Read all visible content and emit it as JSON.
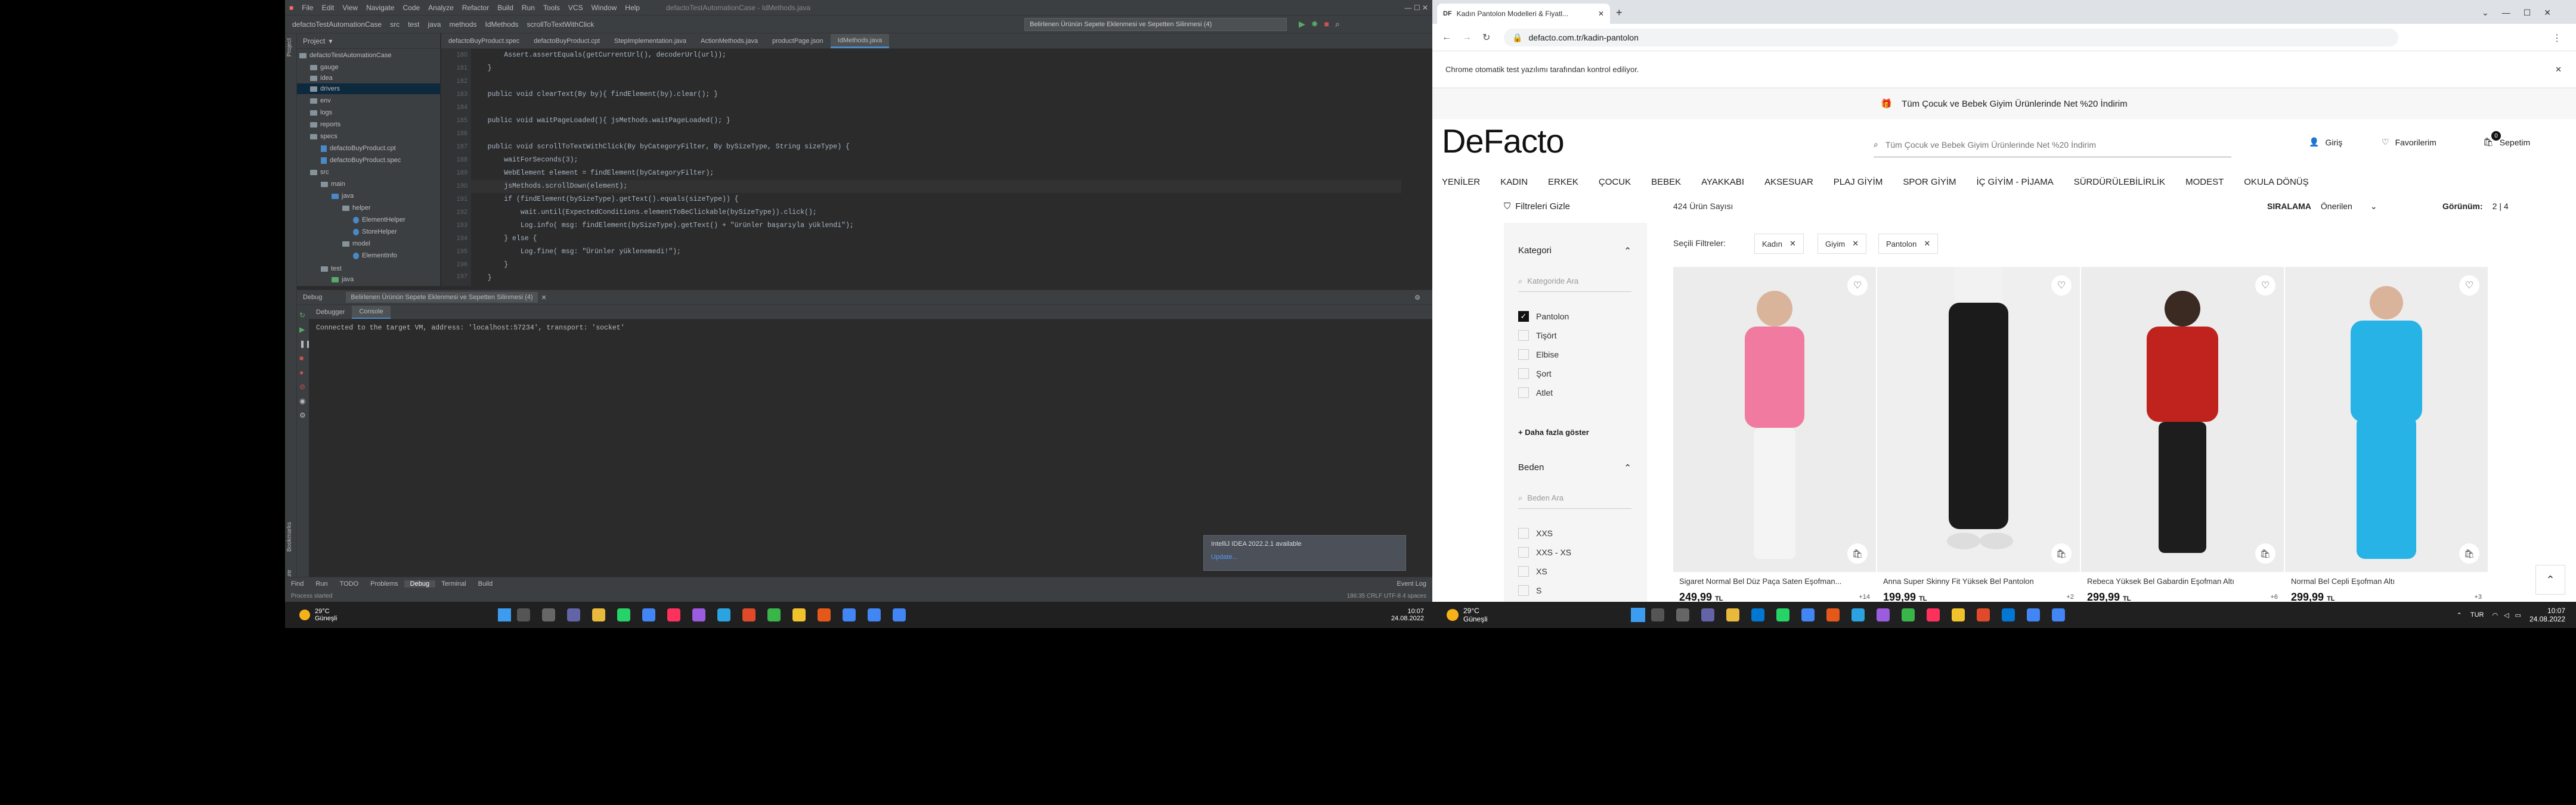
{
  "ide": {
    "menu": [
      "File",
      "Edit",
      "View",
      "Navigate",
      "Code",
      "Analyze",
      "Refactor",
      "Build",
      "Run",
      "Tools",
      "VCS",
      "Window",
      "Help"
    ],
    "title": "defactoTestAutomationCase - IdMethods.java",
    "crumbs": [
      "defactoTestAutomationCase",
      "src",
      "test",
      "java",
      "methods",
      "IdMethods",
      "scrollToTextWithClick"
    ],
    "run_config": "Belirlenen Ürünün Sepete Eklenmesi ve Sepetten Silinmesi (4)",
    "project_label": "Project",
    "tree": [
      "defactoTestAutomationCase",
      "gauge",
      "idea",
      "drivers",
      "env",
      "logs",
      "reports",
      "specs",
      "defactoBuyProduct.cpt",
      "defactoBuyProduct.spec",
      "src",
      "main",
      "java",
      "helper",
      "ElementHelper",
      "StoreHelper",
      "model",
      "ElementInfo",
      "test",
      "java"
    ],
    "tabs": [
      "defactoBuyProduct.spec",
      "defactoBuyProduct.cpt",
      "StepImplementation.java",
      "ActionMethods.java",
      "productPage.json",
      "IdMethods.java"
    ],
    "line_numbers": [
      "180",
      "181",
      "182",
      "183",
      "184",
      "185",
      "186",
      "187",
      "188",
      "189",
      "190",
      "191",
      "192",
      "193",
      "194",
      "195",
      "196",
      "197"
    ],
    "code_lines": [
      "        Assert.assertEquals(getCurrentUrl(), decoderUrl(url));",
      "    }",
      "",
      "    public void clearText(By by){ findElement(by).clear(); }",
      "",
      "    public void waitPageLoaded(){ jsMethods.waitPageLoaded(); }",
      "",
      "    public void scrollToTextWithClick(By byCategoryFilter, By bySizeType, String sizeType) {",
      "        waitForSeconds(3);",
      "        WebElement element = findElement(byCategoryFilter);",
      "        jsMethods.scrollDown(element);",
      "        if (findElement(bySizeType).getText().equals(sizeType)) {",
      "            wait.until(ExpectedConditions.elementToBeClickable(bySizeType)).click();",
      "            Log.info( msg: findElement(bySizeType).getText() + \"ürünler başarıyla yüklendi\");",
      "        } else {",
      "            Log.fine( msg: \"Ürünler yüklenemedi!\");",
      "        }",
      "    }"
    ],
    "debug_title": "Debug",
    "debug_session": "Belirlenen Ürünün Sepete Eklenmesi ve Sepetten Silinmesi (4)",
    "debug_subtabs": [
      "Debugger",
      "Console"
    ],
    "console_text": "Connected to the target VM, address: 'localhost:57234', transport: 'socket'",
    "bottom_tabs": [
      "Find",
      "Run",
      "TODO",
      "Problems",
      "Debug",
      "Terminal",
      "Build"
    ],
    "event_log": "Event Log",
    "status_left": "Process started",
    "status_right": "186:35   CRLF   UTF-8   4 spaces",
    "notif_title": "IntelliJ IDEA 2022.2.1 available",
    "notif_link": "Update..."
  },
  "taskbar_left": {
    "weather_temp": "29°C",
    "weather_desc": "Güneşli",
    "time": "10:07",
    "date": "24.08.2022"
  },
  "taskbar_right": {
    "weather_temp": "29°C",
    "weather_desc": "Güneşli",
    "lang": "TUR",
    "time": "10:07",
    "date": "24.08.2022"
  },
  "browser": {
    "tab_title": "Kadın Pantolon Modelleri & Fiyatl...",
    "url": "defacto.com.tr/kadin-pantolon",
    "automation_notice": "Chrome otomatik test yazılımı tarafından kontrol ediliyor.",
    "promo": "Tüm Çocuk ve Bebek Giyim Ürünlerinde Net %20 İndirim",
    "logo": "DeFacto",
    "search_placeholder": "Tüm Çocuk ve Bebek Giyim Ürünlerinde Net %20 İndirim",
    "login": "Giriş",
    "favorites": "Favorilerim",
    "cart": "Sepetim",
    "cart_count": "0",
    "nav": [
      "YENİLER",
      "KADIN",
      "ERKEK",
      "ÇOCUK",
      "BEBEK",
      "AYAKKABI",
      "AKSESUAR",
      "PLAJ GİYİM",
      "SPOR GİYİM",
      "İÇ GİYİM - PİJAMA",
      "SÜRDÜRÜLEBİLİRLİK",
      "MODEST",
      "OKULA DÖNÜŞ"
    ],
    "clear_filters": "Filtreleri Gizle",
    "count": "424 Ürün Sayısı",
    "sort_label": "SIRALAMA",
    "sort_value": "Önerilen",
    "view_label": "Görünüm:",
    "view_value": "2 | 4",
    "selected_filters_label": "Seçili Filtreler:",
    "selected_filters": [
      "Kadın",
      "Giyim",
      "Pantolon"
    ],
    "category_title": "Kategori",
    "category_search": "Kategoride Ara",
    "categories": [
      {
        "label": "Pantolon",
        "checked": true
      },
      {
        "label": "Tişört",
        "checked": false
      },
      {
        "label": "Elbise",
        "checked": false
      },
      {
        "label": "Şort",
        "checked": false
      },
      {
        "label": "Atlet",
        "checked": false
      }
    ],
    "show_more": "+ Daha fazla göster",
    "size_title": "Beden",
    "size_search": "Beden Ara",
    "sizes": [
      "XXS",
      "XXS - XS",
      "XS",
      "S"
    ],
    "products": [
      {
        "name": "Sigaret Normal Bel Düz Paça Saten Eşofman...",
        "price": "249,99",
        "currency": "TL",
        "colors": "+14",
        "color": "#f07aa0"
      },
      {
        "name": "Anna Super Skinny Fit Yüksek Bel Pantolon",
        "price": "199,99",
        "currency": "TL",
        "colors": "+2",
        "color": "#1b1b1b"
      },
      {
        "name": "Rebeca Yüksek Bel Gabardin Eşofman Altı",
        "price": "299,99",
        "currency": "TL",
        "colors": "+6",
        "color": "#c0221d"
      },
      {
        "name": "Normal Bel Cepli Eşofman Altı",
        "price": "299,99",
        "currency": "TL",
        "colors": "+3",
        "color": "#27b3e6"
      }
    ]
  }
}
